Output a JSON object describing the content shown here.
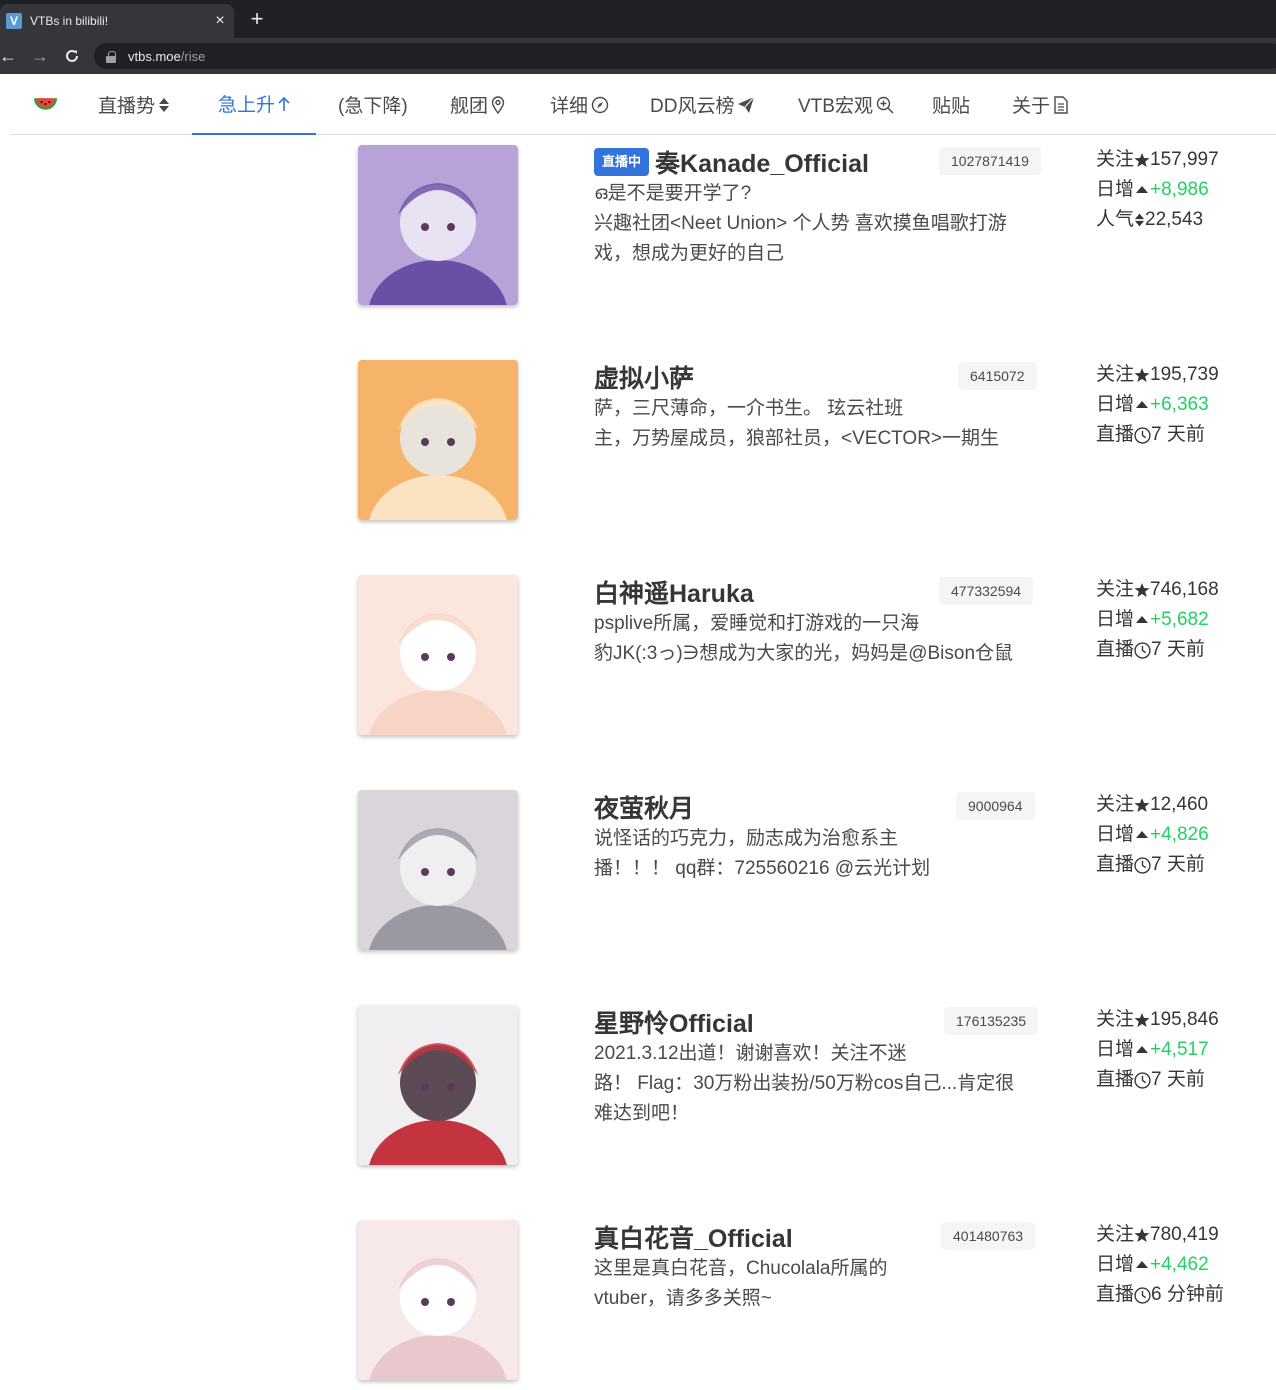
{
  "browser": {
    "tab_title": "VTBs in bilibili!",
    "tab_close": "×",
    "new_tab": "+",
    "url_host": "vtbs.moe",
    "url_path": "/rise"
  },
  "nav": {
    "items": [
      {
        "label": "直播势",
        "icon": "sort-icon"
      },
      {
        "label": "急上升",
        "icon": "arrow-up-icon",
        "active": true
      },
      {
        "label": "(急下降)",
        "icon": ""
      },
      {
        "label": "舰团",
        "icon": "location-pin-icon"
      },
      {
        "label": "详细",
        "icon": "compass-icon"
      },
      {
        "label": "DD风云榜",
        "icon": "paper-plane-icon"
      },
      {
        "label": "VTB宏观",
        "icon": "zoom-in-icon"
      },
      {
        "label": "贴贴",
        "icon": ""
      },
      {
        "label": "关于",
        "icon": "document-icon"
      }
    ]
  },
  "labels": {
    "live": "直播中",
    "follow": "关注",
    "daily": "日增",
    "popularity": "人气",
    "lastlive": "直播"
  },
  "vtbs": [
    {
      "name": "奏Kanade_Official",
      "mid": "1027871419",
      "live": true,
      "sign_lines": [
        "ഒ是不是要开学了?",
        "兴趣社团<Neet Union> 个人势 喜欢摸鱼唱歌打游",
        "戏，想成为更好的自己"
      ],
      "follower": "157,997",
      "rise": "+8,986",
      "third_type": "popularity",
      "third_value": "22,543"
    },
    {
      "name": "虚拟小萨",
      "mid": "6415072",
      "live": false,
      "sign_lines": [
        "萨，三尺薄命，一介书生。 玹云社班",
        "主，万势屋成员，狼部社员，<VECTOR>一期生"
      ],
      "follower": "195,739",
      "rise": "+6,363",
      "third_type": "lastlive",
      "third_value": "7 天前"
    },
    {
      "name": "白神遥Haruka",
      "mid": "477332594",
      "live": false,
      "sign_lines": [
        "psplive所属，爱睡觉和打游戏的一只海",
        "豹JK(:3っ)∋想成为大家的光，妈妈是@Bison仓鼠"
      ],
      "follower": "746,168",
      "rise": "+5,682",
      "third_type": "lastlive",
      "third_value": "7 天前"
    },
    {
      "name": "夜萤秋月",
      "mid": "9000964",
      "live": false,
      "sign_lines": [
        "说怪话的巧克力，励志成为治愈系主",
        "播！！！ qq群：725560216 @云光计划"
      ],
      "follower": "12,460",
      "rise": "+4,826",
      "third_type": "lastlive",
      "third_value": "7 天前"
    },
    {
      "name": "星野怜Official",
      "mid": "176135235",
      "live": false,
      "sign_lines": [
        "2021.3.12出道！谢谢喜欢！关注不迷",
        "路！ Flag：30万粉出装扮/50万粉cos自己...肯定很",
        "难达到吧！"
      ],
      "follower": "195,846",
      "rise": "+4,517",
      "third_type": "lastlive",
      "third_value": "7 天前"
    },
    {
      "name": "真白花音_Official",
      "mid": "401480763",
      "live": false,
      "sign_lines": [
        "这里是真白花音，Chucolala所属的",
        "vtuber，请多多关照~"
      ],
      "follower": "780,419",
      "rise": "+4,462",
      "third_type": "lastlive",
      "third_value": "6 分钟前"
    }
  ],
  "colors": {
    "accent": "#3273dc",
    "rise_green": "#23d160",
    "text": "#363636",
    "tag_bg": "#f5f5f5"
  }
}
